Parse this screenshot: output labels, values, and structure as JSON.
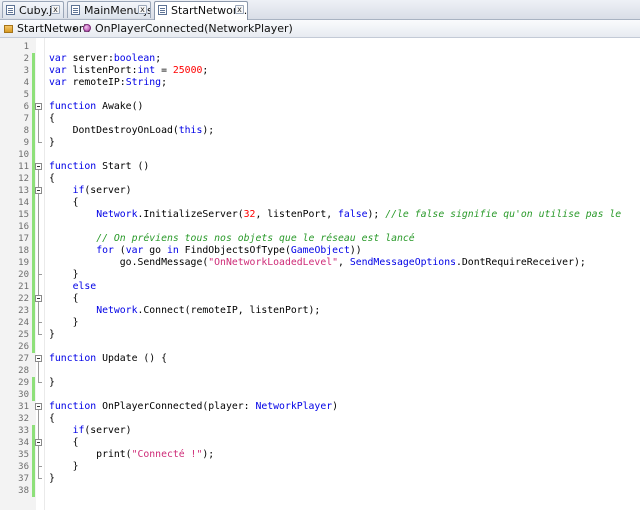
{
  "tabs": [
    {
      "label": "Cuby.js",
      "close": "x",
      "active": false
    },
    {
      "label": "MainMenu.js",
      "close": "x",
      "active": false
    },
    {
      "label": "StartNetwork.js",
      "close": "x",
      "active": true
    }
  ],
  "breadcrumb": {
    "class_name": "StartNetwork",
    "separator": "▸",
    "method": "OnPlayerConnected(NetworkPlayer)"
  },
  "editor": {
    "line_numbers": [
      "1",
      "2",
      "3",
      "4",
      "5",
      "6",
      "7",
      "8",
      "9",
      "10",
      "11",
      "12",
      "13",
      "14",
      "15",
      "16",
      "17",
      "18",
      "19",
      "20",
      "21",
      "22",
      "23",
      "24",
      "25",
      "26",
      "27",
      "28",
      "29",
      "30",
      "31",
      "32",
      "33",
      "34",
      "35",
      "36",
      "37",
      "38"
    ],
    "code_lines": [
      "",
      "var server:boolean;",
      "var listenPort:int = 25000;",
      "var remoteIP:String;",
      "",
      "function Awake()",
      "{",
      "    DontDestroyOnLoad(this);",
      "}",
      "",
      "function Start ()",
      "{",
      "    if(server)",
      "    {",
      "        Network.InitializeServer(32, listenPort, false); //le false signifie qu'on utilise pas le",
      "",
      "        // On préviens tous nos objets que le réseau est lancé",
      "        for (var go in FindObjectsOfType(GameObject))",
      "            go.SendMessage(\"OnNetworkLoadedLevel\", SendMessageOptions.DontRequireReceiver);",
      "    }",
      "    else",
      "    {",
      "        Network.Connect(remoteIP, listenPort);",
      "    }",
      "}",
      "",
      "function Update () {",
      "",
      "}",
      "",
      "function OnPlayerConnected(player: NetworkPlayer)",
      "{",
      "    if(server)",
      "    {",
      "        print(\"Connecté !\");",
      "    }",
      "}",
      ""
    ],
    "keywords": [
      "var",
      "boolean",
      "int",
      "String",
      "function",
      "this",
      "if",
      "false",
      "for",
      "in",
      "else"
    ],
    "colors": {
      "keyword": "#0000e6",
      "number": "#ff0000",
      "string": "#ce2b77",
      "comment": "#2a9a2a",
      "change_marker": "#8ee07a"
    }
  }
}
